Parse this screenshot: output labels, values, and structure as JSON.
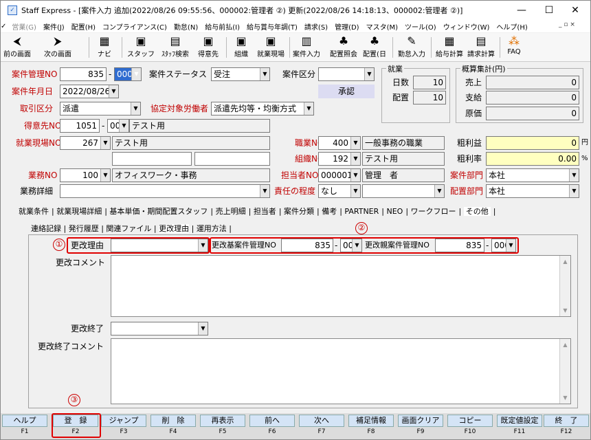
{
  "window": {
    "title": "Staff Express - [案件入力 追加(2022/08/26 09:55:56、000002:管理者 ②) 更新(2022/08/26 14:18:13、000002:管理者 ②)]",
    "min": "—",
    "max": "☐",
    "close": "✕"
  },
  "menu": [
    "営業(G)",
    "案件(J)",
    "配置(H)",
    "コンプライアンス(C)",
    "勤怠(N)",
    "給与前払(I)",
    "給与賞与年調(T)",
    "請求(S)",
    "管理(D)",
    "マスタ(M)",
    "ツール(O)",
    "ウィンドウ(W)",
    "ヘルプ(H)"
  ],
  "mdi_controls": "_ ▫ ×",
  "toolbar": [
    {
      "label": "前の画面",
      "icon": "back-icon",
      "glyph": "⮜"
    },
    {
      "label": "次の画面",
      "icon": "forward-icon",
      "glyph": "⮞"
    },
    {
      "label": "ナビ",
      "icon": "navi-icon",
      "glyph": "▦"
    },
    {
      "label": "スタッフ",
      "icon": "staff-icon",
      "glyph": "▣"
    },
    {
      "label": "ｽﾀｯﾌ検索",
      "icon": "staff-search-icon",
      "glyph": "▤"
    },
    {
      "label": "得意先",
      "icon": "client-icon",
      "glyph": "▣"
    },
    {
      "label": "組織",
      "icon": "org-icon",
      "glyph": "▣"
    },
    {
      "label": "就業現場",
      "icon": "worksite-icon",
      "glyph": "▣"
    },
    {
      "label": "案件入力",
      "icon": "case-entry-icon",
      "glyph": "▥"
    },
    {
      "label": "配置照会",
      "icon": "placement-query-icon",
      "glyph": "♣"
    },
    {
      "label": "配置(日",
      "icon": "placement-day-icon",
      "glyph": "♣"
    },
    {
      "label": "勤怠入力",
      "icon": "attendance-icon",
      "glyph": "✎"
    },
    {
      "label": "給与計算",
      "icon": "payroll-icon",
      "glyph": "▦"
    },
    {
      "label": "請求計算",
      "icon": "billing-icon",
      "glyph": "▤"
    },
    {
      "label": "FAQ",
      "icon": "faq-icon",
      "glyph": "⁂"
    }
  ],
  "form": {
    "case_no_label": "案件管理NO",
    "case_no": "835",
    "case_branch": "000",
    "case_status_label": "案件ステータス",
    "case_status": "受注",
    "case_type_label": "案件区分",
    "case_type": "",
    "case_date_label": "案件年月日",
    "case_date": "2022/08/26",
    "approve": "承認",
    "trade_label": "取引区分",
    "trade": "派遣",
    "agreement_label": "協定対象労働者",
    "agreement": "派遣先均等・均衡方式",
    "client_label": "得意先NO",
    "client_no": "1051",
    "client_branch": "000",
    "client_name": "テスト用",
    "site_label": "就業現場NO",
    "site_no": "267",
    "site_name": "テスト用",
    "job_label": "職業NO",
    "job_no": "400",
    "job_name": "一般事務の職業",
    "org_label": "組織NO",
    "org_no": "192",
    "org_name": "テスト用",
    "task_label": "業務NO",
    "task_no": "100",
    "task_name": "オフィスワーク・事務",
    "person_label": "担当者NO",
    "person_no": "000001",
    "person_name": "管理　者",
    "task_detail_label": "業務詳細",
    "task_detail": "",
    "resp_label": "責任の程度",
    "resp": "なし",
    "resp2": "",
    "case_dept_label": "案件部門",
    "case_dept": "本社",
    "place_dept_label": "配置部門",
    "place_dept": "本社"
  },
  "work": {
    "title": "就業",
    "days_label": "日数",
    "days": "10",
    "placed_label": "配置",
    "placed": "10"
  },
  "summary": {
    "title": "概算集計(円)",
    "sales_label": "売上",
    "sales": "0",
    "pay_label": "支給",
    "pay": "0",
    "cost_label": "原価",
    "cost": "0",
    "gross_label": "粗利益",
    "gross": "0",
    "gross_unit": "円",
    "rate_label": "粗利率",
    "rate": "0.00",
    "rate_unit": "%"
  },
  "tabs1": [
    "就業条件",
    "就業現場詳細",
    "基本単価・期間配置スタッフ",
    "売上明細",
    "担当者",
    "案件分類",
    "備考",
    "PARTNER",
    "NEO",
    "ワークフロー",
    "その他"
  ],
  "tabs2": [
    "連絡記録",
    "発行履歴",
    "関連ファイル",
    "更改理由",
    "運用方法"
  ],
  "change": {
    "reason_label": "更改理由",
    "reason": "",
    "base_label": "更改基案件管理NO",
    "base_no": "835",
    "base_branch": "000",
    "parent_label": "更改親案件管理NO",
    "parent_no": "835",
    "parent_branch": "000",
    "comment_label": "更改コメント",
    "comment": "",
    "end_label": "更改終了",
    "end": "",
    "end_comment_label": "更改終了コメント",
    "end_comment": ""
  },
  "markers": {
    "m1": "①",
    "m2": "②",
    "m3": "③"
  },
  "fkeys": [
    {
      "label": "ヘルプ",
      "key": "F1"
    },
    {
      "label": "登　録",
      "key": "F2"
    },
    {
      "label": "ジャンプ",
      "key": "F3"
    },
    {
      "label": "削　除",
      "key": "F4"
    },
    {
      "label": "再表示",
      "key": "F5"
    },
    {
      "label": "前へ",
      "key": "F6"
    },
    {
      "label": "次へ",
      "key": "F7"
    },
    {
      "label": "補足情報",
      "key": "F8"
    },
    {
      "label": "画面クリア",
      "key": "F9"
    },
    {
      "label": "コピー",
      "key": "F10"
    },
    {
      "label": "既定値設定",
      "key": "F11"
    },
    {
      "label": "終　了",
      "key": "F12"
    }
  ],
  "colors": {
    "required": "#c00000",
    "highlight": "#e00000",
    "selected": "#2f6cd0",
    "yellow": "#ffffc0"
  }
}
